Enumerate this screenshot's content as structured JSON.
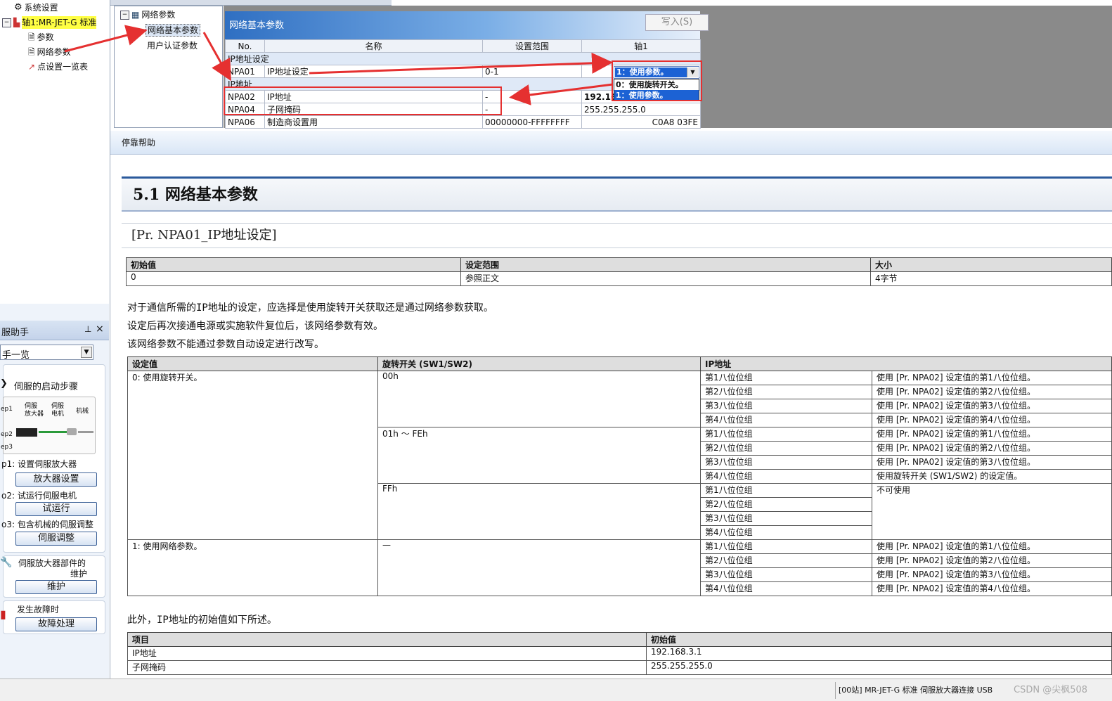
{
  "left_tree": {
    "items": [
      {
        "label": "系统设置"
      },
      {
        "label": "轴1:MR-JET-G 标准"
      },
      {
        "label": "参数"
      },
      {
        "label": "网络参数"
      },
      {
        "label": "点设置一览表"
      }
    ]
  },
  "helper": {
    "title": "服助手",
    "pin": "ᵖ",
    "close": "×",
    "select_value": "手一览",
    "startup": "伺服的启动步骤",
    "diagram": {
      "amp": "伺服\n放大器",
      "motor": "伺服\n电机",
      "machine": "机械",
      "ep1": "ep1",
      "ep2": "ep2",
      "ep3": "ep3"
    },
    "step1_label": "p1: 设置伺服放大器",
    "step1_button": "放大器设置",
    "step2_label": "o2: 试运行伺服电机",
    "step2_button": "试运行",
    "step3_label": "o3: 包含机械的伺服调整",
    "step3_button": "伺服调整",
    "maint_label1": "伺服放大器部件的",
    "maint_label2": "维护",
    "maint_button": "维护",
    "fault_label": "发生故障时",
    "fault_button": "故障处理"
  },
  "param_tree": {
    "root": "网络参数",
    "children": [
      "网络基本参数",
      "用户认证参数"
    ]
  },
  "grid": {
    "title": "网络基本参数",
    "write_button": "写入(S)",
    "headers": [
      "No.",
      "名称",
      "设置范围",
      "轴1"
    ],
    "section1": "IP地址设定",
    "section2": "IP地址",
    "rows": [
      {
        "no": "NPA01",
        "name": "IP地址设定",
        "range": "0-1",
        "value": "1：使用参数。"
      },
      {
        "no": "NPA02",
        "name": "IP地址",
        "range": "-",
        "value": "192.16"
      },
      {
        "no": "NPA04",
        "name": "子网掩码",
        "range": "-",
        "value": "255.255.255.0"
      },
      {
        "no": "NPA06",
        "name": "制造商设置用",
        "range": "00000000-FFFFFFFF",
        "value": "C0A8 03FE"
      }
    ],
    "dropdown_options": [
      "0：使用旋转开关。",
      "1：使用参数。"
    ]
  },
  "help_bar": {
    "label": "停靠帮助"
  },
  "doc": {
    "section_title": "5.1 网络基本参数",
    "subtitle": "[Pr. NPA01_IP地址设定]",
    "info_table": {
      "headers": [
        "初始值",
        "设定范围",
        "大小"
      ],
      "values": [
        "0",
        "参照正文",
        "4字节"
      ]
    },
    "paragraphs": [
      "对于通信所需的IP地址的设定，应选择是使用旋转开关获取还是通过网络参数获取。",
      "设定后再次接通电源或实施软件复位后，该网络参数有效。",
      "该网络参数不能通过参数自动设定进行改写。"
    ],
    "main_table": {
      "headers": [
        "设定值",
        "旋转开关 (SW1/SW2)",
        "IP地址"
      ],
      "set0": "0: 使用旋转开关。",
      "set1": "1: 使用网络参数。",
      "sw_00": "00h",
      "sw_01fe": "01h ～ FEh",
      "sw_ff": "FFh",
      "sw_dash": "—",
      "octets": [
        "第1八位位组",
        "第2八位位组",
        "第3八位位组",
        "第4八位位组"
      ],
      "use_npa02": [
        "使用 [Pr. NPA02] 设定值的第1八位位组。",
        "使用 [Pr. NPA02] 设定值的第2八位位组。",
        "使用 [Pr. NPA02] 设定值的第3八位位组。",
        "使用 [Pr. NPA02] 设定值的第4八位位组。"
      ],
      "use_sw": "使用旋转开关 (SW1/SW2) 的设定值。",
      "not_usable": "不可使用"
    },
    "para2": "此外，IP地址的初始值如下所述。",
    "init_table": {
      "headers": [
        "项目",
        "初始值"
      ],
      "rows": [
        [
          "IP地址",
          "192.168.3.1"
        ],
        [
          "子网掩码",
          "255.255.255.0"
        ]
      ]
    }
  },
  "status": {
    "text": "[00站] MR-JET-G 标准 伺服放大器连接 USB",
    "watermark": "CSDN @尖枫508"
  },
  "colors": {
    "annotation_red": "#e53030",
    "grid_header_blue": "#2f6fc2",
    "selection_blue": "#1c62d4",
    "highlight_yellow": "#ffff44"
  }
}
